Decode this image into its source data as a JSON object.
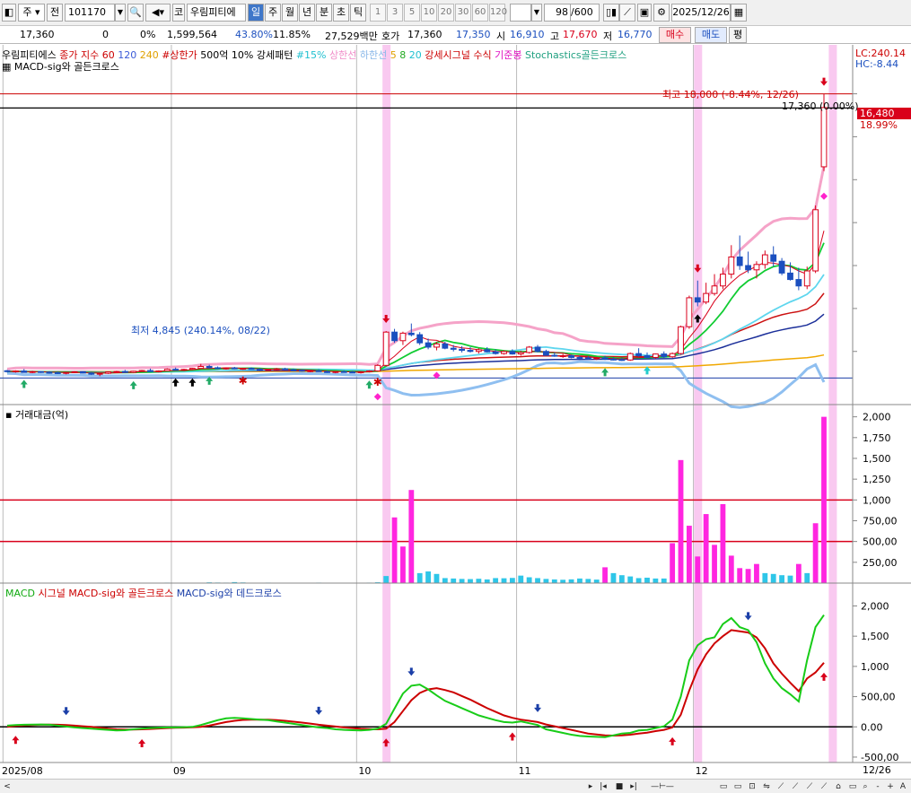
{
  "toolbar": {
    "market_label": "주",
    "prev_label": "전",
    "code_value": "101170",
    "name_prefix": "코",
    "stock_name": "우림피티에",
    "periods": [
      "일",
      "주",
      "월",
      "년",
      "분",
      "초",
      "틱"
    ],
    "selected_period": "일",
    "intervals": [
      "1",
      "3",
      "5",
      "10",
      "20",
      "30",
      "60",
      "120"
    ],
    "count_value": "98",
    "count_total": "/600",
    "date_value": "2025/12/26"
  },
  "quote": {
    "price": "17,360",
    "change": "0",
    "change_pct": "0%",
    "volume": "1,599,564",
    "turnover_pct": "43.80%",
    "other_pct": "11.85%",
    "amount": "27,529백만",
    "bid_label": "호가",
    "bid1": "17,360",
    "bid2": "17,350",
    "open_label": "시",
    "open": "16,910",
    "high_label": "고",
    "high": "17,670",
    "low_label": "저",
    "low": "16,770",
    "buy_label": "매수",
    "sell_label": "매도",
    "avg_label": "평"
  },
  "colors": {
    "up": "#d9001b",
    "down": "#1b4fbf",
    "highlight": "#f9c6ef",
    "ma5": "#d9001b",
    "ma20": "#11cc33",
    "ma60": "#5ed6ee",
    "ma120": "#cc1111",
    "ma240": "#f0a800",
    "env_up": "#f5a3c8",
    "env_low": "#8fbff0",
    "macd": "#18cc18",
    "signal": "#cc0000",
    "vol_big": "#ff26e0",
    "vol_small": "#2ec6e8"
  },
  "price_panel": {
    "legend_row1": [
      {
        "text": "우림피티에스",
        "color": "#000000"
      },
      {
        "text": "종가 지수 60",
        "color": "#cc0000"
      },
      {
        "text": "120",
        "color": "#3a5ad8"
      },
      {
        "text": "240",
        "color": "#e0a000"
      },
      {
        "text": "#상한가",
        "color": "#cc0000"
      },
      {
        "text": "500억 10% 강세패턴",
        "color": "#000000"
      },
      {
        "text": "#15%",
        "color": "#20c0d0"
      },
      {
        "text": "상한선",
        "color": "#f08cc8"
      },
      {
        "text": "하한선",
        "color": "#8ab8e8"
      },
      {
        "text": "5",
        "color": "#e0a000"
      },
      {
        "text": "8",
        "color": "#22aa22"
      },
      {
        "text": "20",
        "color": "#20c0d0"
      },
      {
        "text": "강세시그널 수식",
        "color": "#cc0000"
      },
      {
        "text": "기준봉",
        "color": "#e010c0"
      },
      {
        "text": "Stochastics골든크로스",
        "color": "#20a080"
      }
    ],
    "legend_row2": "MACD-sig와 골든크로스",
    "lc_label": "LC:240.14",
    "hc_label": "HC:-8.44",
    "max_label": "최고 18,000 (-8.44%, 12/26)",
    "min_label": "최저 4,845 (240.14%, 08/22)",
    "current_label": "17,360 (0.00%)",
    "side_price": "16,480",
    "side_pct": "18.99%",
    "candles": [
      [
        5100,
        5140,
        5020,
        5060
      ],
      [
        5080,
        5120,
        5010,
        5090
      ],
      [
        5090,
        5180,
        5050,
        5020
      ],
      [
        5020,
        5100,
        4990,
        5060
      ],
      [
        5060,
        5090,
        5000,
        5030
      ],
      [
        5030,
        5080,
        4960,
        5010
      ],
      [
        5010,
        5060,
        4950,
        4990
      ],
      [
        4990,
        5050,
        4930,
        5020
      ],
      [
        5020,
        5080,
        4990,
        5050
      ],
      [
        5050,
        5090,
        4980,
        4990
      ],
      [
        4990,
        5040,
        4900,
        4940
      ],
      [
        4940,
        5010,
        4845,
        4980
      ],
      [
        4980,
        5060,
        4950,
        5040
      ],
      [
        5040,
        5100,
        5000,
        5070
      ],
      [
        5070,
        5140,
        5030,
        5020
      ],
      [
        5020,
        5100,
        4990,
        5080
      ],
      [
        5080,
        5140,
        5040,
        5110
      ],
      [
        5110,
        5200,
        5080,
        5060
      ],
      [
        5060,
        5120,
        5020,
        5090
      ],
      [
        5090,
        5210,
        5070,
        5170
      ],
      [
        5170,
        5250,
        5120,
        5130
      ],
      [
        5130,
        5190,
        5080,
        5160
      ],
      [
        5160,
        5230,
        5120,
        5210
      ],
      [
        5210,
        5420,
        5180,
        5300
      ],
      [
        5300,
        5380,
        5200,
        5240
      ],
      [
        5240,
        5300,
        5170,
        5200
      ],
      [
        5200,
        5260,
        5150,
        5230
      ],
      [
        5230,
        5280,
        5170,
        5190
      ],
      [
        5190,
        5240,
        5140,
        5210
      ],
      [
        5210,
        5260,
        5150,
        5170
      ],
      [
        5170,
        5220,
        5100,
        5130
      ],
      [
        5130,
        5190,
        5090,
        5160
      ],
      [
        5160,
        5230,
        5120,
        5190
      ],
      [
        5190,
        5240,
        5120,
        5150
      ],
      [
        5150,
        5200,
        5090,
        5120
      ],
      [
        5120,
        5160,
        5050,
        5080
      ],
      [
        5080,
        5140,
        5030,
        5100
      ],
      [
        5100,
        5170,
        5050,
        5060
      ],
      [
        5060,
        5110,
        5000,
        5030
      ],
      [
        5030,
        5090,
        4980,
        5060
      ],
      [
        5060,
        5120,
        5020,
        5040
      ],
      [
        5040,
        5090,
        4990,
        5010
      ],
      [
        5010,
        5070,
        4970,
        5050
      ],
      [
        5050,
        5120,
        5020,
        5090
      ],
      [
        5090,
        5400,
        5060,
        5350
      ],
      [
        5350,
        6950,
        5300,
        6900
      ],
      [
        6900,
        7050,
        6400,
        6500
      ],
      [
        6500,
        6920,
        6300,
        6850
      ],
      [
        6850,
        7300,
        6700,
        6780
      ],
      [
        6780,
        6900,
        6300,
        6400
      ],
      [
        6400,
        6600,
        6100,
        6200
      ],
      [
        6200,
        6450,
        6050,
        6350
      ],
      [
        6350,
        6450,
        6100,
        6150
      ],
      [
        6150,
        6300,
        6000,
        6100
      ],
      [
        6100,
        6250,
        5950,
        6050
      ],
      [
        6050,
        6200,
        5950,
        6000
      ],
      [
        6000,
        6150,
        5900,
        6080
      ],
      [
        6080,
        6200,
        5950,
        5980
      ],
      [
        5980,
        6100,
        5850,
        5900
      ],
      [
        5900,
        6050,
        5850,
        6000
      ],
      [
        6000,
        6100,
        5850,
        5880
      ],
      [
        5880,
        6030,
        5800,
        5950
      ],
      [
        5950,
        6250,
        5900,
        6200
      ],
      [
        6200,
        6300,
        5950,
        6000
      ],
      [
        6000,
        6080,
        5800,
        5820
      ],
      [
        5820,
        5950,
        5750,
        5780
      ],
      [
        5780,
        5880,
        5700,
        5800
      ],
      [
        5800,
        5850,
        5680,
        5720
      ],
      [
        5720,
        5800,
        5650,
        5700
      ],
      [
        5700,
        5780,
        5620,
        5660
      ],
      [
        5660,
        5750,
        5600,
        5700
      ],
      [
        5700,
        5800,
        5600,
        5640
      ],
      [
        5640,
        5720,
        5580,
        5620
      ],
      [
        5620,
        5700,
        5550,
        5600
      ],
      [
        5600,
        5950,
        5560,
        5900
      ],
      [
        5900,
        6150,
        5750,
        5800
      ],
      [
        5800,
        5950,
        5680,
        5720
      ],
      [
        5720,
        5900,
        5650,
        5880
      ],
      [
        5880,
        6000,
        5700,
        5750
      ],
      [
        5750,
        5950,
        5700,
        5900
      ],
      [
        5900,
        7200,
        5850,
        7150
      ],
      [
        7150,
        8600,
        7050,
        8500
      ],
      [
        8500,
        9300,
        8100,
        8300
      ],
      [
        8300,
        9200,
        8200,
        8700
      ],
      [
        8700,
        9600,
        8600,
        9050
      ],
      [
        9050,
        9900,
        8900,
        9600
      ],
      [
        9600,
        10950,
        9400,
        10400
      ],
      [
        10400,
        11400,
        9800,
        10000
      ],
      [
        10000,
        10650,
        9650,
        9800
      ],
      [
        9800,
        10200,
        9400,
        10050
      ],
      [
        10050,
        10700,
        9850,
        10500
      ],
      [
        10500,
        10900,
        9950,
        10200
      ],
      [
        10200,
        10350,
        9550,
        9650
      ],
      [
        9650,
        10150,
        9300,
        9350
      ],
      [
        9350,
        9900,
        8850,
        9050
      ],
      [
        9050,
        9950,
        8900,
        9750
      ],
      [
        9750,
        12800,
        9650,
        12600
      ],
      [
        14600,
        18000,
        14400,
        17360
      ]
    ],
    "markers": [
      {
        "i": 2,
        "type": "up_arrow",
        "color": "#22aa66"
      },
      {
        "i": 15,
        "type": "up_arrow",
        "color": "#22aa66"
      },
      {
        "i": 20,
        "type": "up_arrow",
        "color": "#000000"
      },
      {
        "i": 22,
        "type": "up_arrow",
        "color": "#000000"
      },
      {
        "i": 24,
        "type": "up_arrow",
        "color": "#22aa66"
      },
      {
        "i": 28,
        "type": "star",
        "color": "#cc0000"
      },
      {
        "i": 43,
        "type": "up_arrow",
        "color": "#22aa66"
      },
      {
        "i": 44,
        "type": "star",
        "color": "#cc0000"
      },
      {
        "i": 44,
        "type": "diamond",
        "color": "#ff22cc"
      },
      {
        "i": 45,
        "type": "down_arrow",
        "color": "#d9001b"
      },
      {
        "i": 51,
        "type": "diamond",
        "color": "#ff22cc"
      },
      {
        "i": 71,
        "type": "up_arrow",
        "color": "#22aa66"
      },
      {
        "i": 76,
        "type": "up_arrow",
        "color": "#22cccc"
      },
      {
        "i": 82,
        "type": "up_arrow",
        "color": "#000000"
      },
      {
        "i": 82,
        "type": "down_arrow",
        "color": "#d9001b"
      },
      {
        "i": 97,
        "type": "down_arrow",
        "color": "#d9001b"
      },
      {
        "i": 97,
        "type": "diamond",
        "color": "#ff22cc"
      }
    ],
    "x_ticks": [
      {
        "i": 0,
        "label": "2025/08"
      },
      {
        "i": 20,
        "label": "09"
      },
      {
        "i": 42,
        "label": "10"
      },
      {
        "i": 61,
        "label": "11"
      },
      {
        "i": 82,
        "label": "12"
      }
    ],
    "end_label": "12/26",
    "highlight_idx": [
      45,
      82,
      98
    ]
  },
  "volume_panel": {
    "title": "거래대금(억)",
    "y_ticks": [
      "2,000",
      "1,750",
      "1,500",
      "1,250",
      "1,000",
      "750,00",
      "500,00",
      "250,00"
    ],
    "ref_lines": [
      1000,
      500
    ],
    "values": [
      4,
      3,
      6,
      4,
      5,
      3,
      4,
      3,
      2,
      4,
      3,
      6,
      5,
      4,
      3,
      4,
      5,
      3,
      4,
      6,
      4,
      3,
      5,
      4,
      9,
      7,
      6,
      12,
      8,
      5,
      4,
      6,
      5,
      4,
      3,
      4,
      5,
      6,
      5,
      4,
      3,
      4,
      5,
      6,
      10,
      85,
      790,
      440,
      1120,
      120,
      140,
      110,
      60,
      55,
      50,
      48,
      52,
      44,
      60,
      58,
      62,
      90,
      70,
      60,
      50,
      44,
      40,
      45,
      55,
      50,
      42,
      190,
      120,
      95,
      80,
      60,
      65,
      55,
      55,
      480,
      1480,
      690,
      320,
      830,
      460,
      950,
      330,
      180,
      170,
      230,
      120,
      110,
      95,
      90,
      230,
      120,
      720,
      2000
    ],
    "y_max": 2050
  },
  "macd_panel": {
    "legend": [
      {
        "text": "MACD",
        "color": "#11aa11"
      },
      {
        "text": "시그널",
        "color": "#cc0000"
      },
      {
        "text": "MACD-sig와 골든크로스",
        "color": "#cc0000"
      },
      {
        "text": "MACD-sig와 데드크로스",
        "color": "#1b3fa8"
      }
    ],
    "y_ticks": [
      "2,000",
      "1,500",
      "1,000",
      "500,00",
      "0.00",
      "-500,00"
    ],
    "y_min": -560,
    "y_max": 2200,
    "macd": [
      20,
      30,
      35,
      38,
      40,
      35,
      20,
      5,
      -10,
      -20,
      -30,
      -40,
      -50,
      -60,
      -55,
      -40,
      -30,
      -20,
      -15,
      -10,
      -10,
      -5,
      0,
      30,
      70,
      110,
      140,
      150,
      140,
      130,
      120,
      110,
      90,
      70,
      50,
      30,
      10,
      -10,
      -20,
      -40,
      -50,
      -55,
      -60,
      -50,
      -30,
      50,
      300,
      550,
      680,
      700,
      620,
      520,
      430,
      370,
      310,
      250,
      190,
      150,
      110,
      80,
      70,
      90,
      60,
      30,
      -40,
      -70,
      -100,
      -130,
      -150,
      -160,
      -165,
      -170,
      -140,
      -110,
      -100,
      -60,
      -50,
      -20,
      10,
      120,
      500,
      1100,
      1350,
      1450,
      1480,
      1700,
      1800,
      1650,
      1600,
      1400,
      1050,
      800,
      640,
      540,
      420,
      1100,
      1650,
      1850
    ],
    "signal": [
      0,
      15,
      25,
      30,
      35,
      38,
      35,
      30,
      20,
      10,
      0,
      -15,
      -30,
      -40,
      -45,
      -45,
      -40,
      -35,
      -28,
      -20,
      -15,
      -12,
      -8,
      0,
      20,
      50,
      80,
      100,
      115,
      120,
      120,
      118,
      110,
      100,
      85,
      70,
      55,
      35,
      20,
      5,
      -10,
      -20,
      -32,
      -38,
      -40,
      -30,
      80,
      260,
      440,
      560,
      620,
      640,
      610,
      570,
      510,
      450,
      380,
      310,
      250,
      190,
      150,
      120,
      100,
      80,
      40,
      10,
      -20,
      -50,
      -80,
      -110,
      -125,
      -140,
      -145,
      -140,
      -130,
      -110,
      -95,
      -70,
      -50,
      -10,
      200,
      600,
      950,
      1200,
      1380,
      1500,
      1600,
      1580,
      1560,
      1480,
      1300,
      1050,
      880,
      730,
      590,
      800,
      900,
      1060
    ],
    "golden_idx": [
      1,
      16,
      45,
      60,
      79,
      97
    ],
    "dead_idx": [
      7,
      37,
      48,
      63,
      88
    ]
  }
}
